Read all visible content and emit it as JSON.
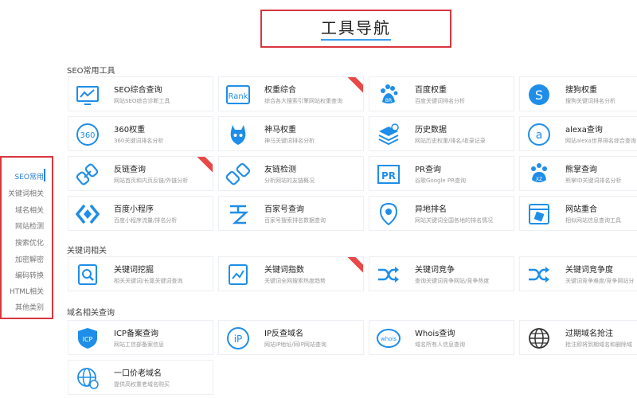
{
  "page_title": "工具导航",
  "sidebar": {
    "items": [
      "SEO常用",
      "关键词相关",
      "域名相关",
      "网站检测",
      "搜索优化",
      "加密解密",
      "编码转换",
      "HTML相关",
      "其他类别"
    ]
  },
  "sections": [
    {
      "title": "SEO常用工具",
      "tools": [
        {
          "name": "SEO综合查询",
          "desc": "网站SEO综合诊断工具",
          "icon": "monitor-chart-icon"
        },
        {
          "name": "权重综合",
          "desc": "综合各大搜索引擎网站权重查询",
          "icon": "rank-icon",
          "badge": true
        },
        {
          "name": "百度权重",
          "desc": "百度关键词排名分析",
          "icon": "baidu-paw-icon"
        },
        {
          "name": "搜狗权重",
          "desc": "搜狗关键词排名分析",
          "icon": "sogou-icon"
        },
        {
          "name": "360权重",
          "desc": "360关键词排名分析",
          "icon": "360-icon"
        },
        {
          "name": "神马权重",
          "desc": "神马关键词排名分析",
          "icon": "shenma-icon"
        },
        {
          "name": "历史数据",
          "desc": "网站历史权重/排名/收录记录",
          "icon": "history-layers-icon"
        },
        {
          "name": "alexa查询",
          "desc": "网站alexa世界排名综合查询",
          "icon": "alexa-icon"
        },
        {
          "name": "反链查询",
          "desc": "网站首页和内页反链/外链分析",
          "icon": "backlink-icon",
          "badge": true
        },
        {
          "name": "友链检测",
          "desc": "分析网站的友链概况",
          "icon": "friend-link-icon"
        },
        {
          "name": "PR查询",
          "desc": "谷歌Google PR查询",
          "icon": "pr-icon"
        },
        {
          "name": "熊掌查询",
          "desc": "熊掌ID关键词排名分析",
          "icon": "bear-paw-icon"
        },
        {
          "name": "百度小程序",
          "desc": "百度小程序流量/排名分析",
          "icon": "baidu-miniapp-icon"
        },
        {
          "name": "百家号查询",
          "desc": "百家号搜索排名数据查询",
          "icon": "baijiahao-icon"
        },
        {
          "name": "异地排名",
          "desc": "网站关键词全国各地的排名情况",
          "icon": "location-pin-icon"
        },
        {
          "name": "网站重合",
          "desc": "相似网站信息查询工具",
          "icon": "site-overlap-icon"
        }
      ]
    },
    {
      "title": "关键词相关",
      "tools": [
        {
          "name": "关键词挖掘",
          "desc": "相关关键词/长尾关键词查询",
          "icon": "keyword-dig-icon"
        },
        {
          "name": "关键词指数",
          "desc": "关键词全网搜索热度趋势",
          "icon": "keyword-index-icon",
          "badge": true
        },
        {
          "name": "关键词竞争",
          "desc": "查询关键词竞争网站/竞争热度",
          "icon": "shuffle-icon"
        },
        {
          "name": "关键词竞争度",
          "desc": "关键词竞争难度/竞争网站分",
          "icon": "shuffle-icon"
        }
      ]
    },
    {
      "title": "域名相关查询",
      "tools": [
        {
          "name": "ICP备案查询",
          "desc": "网站工信部备案信息",
          "icon": "icp-shield-icon"
        },
        {
          "name": "IP反查域名",
          "desc": "网站IP地址/同IP网站查询",
          "icon": "ip-pin-icon"
        },
        {
          "name": "Whois查询",
          "desc": "域名所有人信息查询",
          "icon": "whois-icon"
        },
        {
          "name": "过期域名抢注",
          "desc": "抢注即将到期域名和删除域",
          "icon": "globe-icon"
        },
        {
          "name": "一口价老域名",
          "desc": "提供高权重老域名购买",
          "icon": "globe-price-icon"
        }
      ]
    }
  ],
  "colors": {
    "accent": "#2a7fd4",
    "icon_blue": "#1f8ee8",
    "highlight_border": "#d9363e",
    "badge": "#e84848"
  }
}
